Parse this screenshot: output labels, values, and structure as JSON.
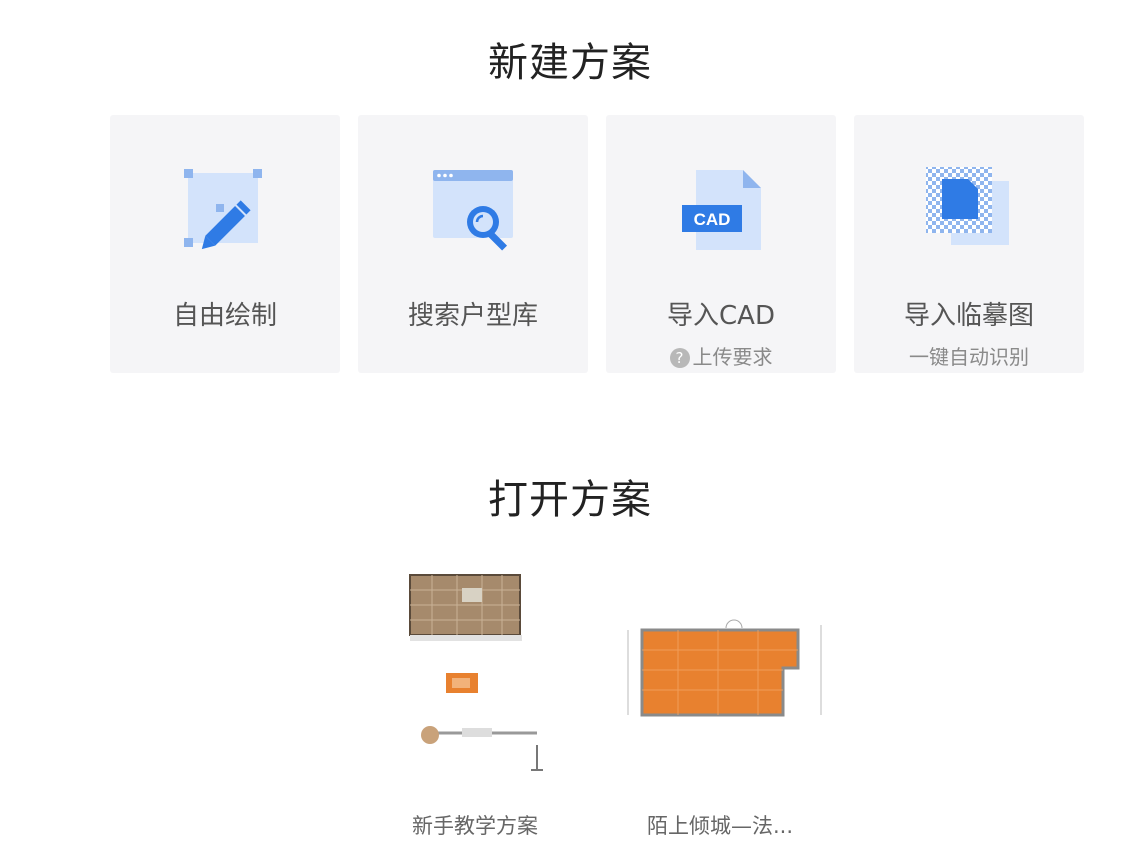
{
  "new_section": {
    "title": "新建方案",
    "cards": [
      {
        "label": "自由绘制",
        "icon": "free-draw-icon"
      },
      {
        "label": "搜索户型库",
        "icon": "search-floorplan-icon"
      },
      {
        "label": "导入CAD",
        "icon": "cad-file-icon",
        "sub": "上传要求",
        "sub_icon": "help-icon",
        "icon_text": "CAD"
      },
      {
        "label": "导入临摹图",
        "icon": "trace-image-icon",
        "sub": "一键自动识别"
      }
    ]
  },
  "open_section": {
    "title": "打开方案",
    "plans": [
      {
        "name": "新手教学方案"
      },
      {
        "name": "陌上倾城—法..."
      }
    ]
  },
  "colors": {
    "accent": "#2f7be5",
    "accent_light": "#d3e3fb",
    "card_bg": "#f5f5f7",
    "floor_orange": "#e8812f",
    "floor_brown": "#a68a6c"
  }
}
